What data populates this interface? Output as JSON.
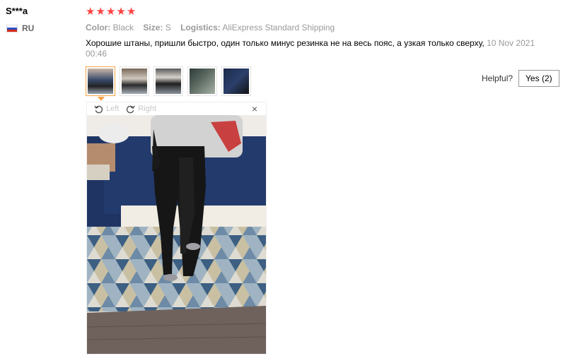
{
  "user": {
    "name": "S***a",
    "country_code": "RU"
  },
  "rating": {
    "stars": 5
  },
  "attributes": {
    "color_label": "Color:",
    "color_value": "Black",
    "size_label": "Size:",
    "size_value": "S",
    "logistics_label": "Logistics:",
    "logistics_value": "AliExpress Standard Shipping"
  },
  "review": {
    "text": "Хорошие штаны, пришли быстро, один только минус резинка не на весь пояс, а узкая только сверху,",
    "date": "10 Nov 2021 00:46"
  },
  "thumbnails": [
    "photo-1",
    "photo-2",
    "photo-3",
    "photo-4",
    "photo-5"
  ],
  "helpful": {
    "label": "Helpful?",
    "button": "Yes (2)"
  },
  "viewer": {
    "rotate_left": "Left",
    "rotate_right": "Right",
    "close": "×"
  },
  "colors": {
    "star": "#ff4444",
    "active_thumb": "#f7a347"
  }
}
